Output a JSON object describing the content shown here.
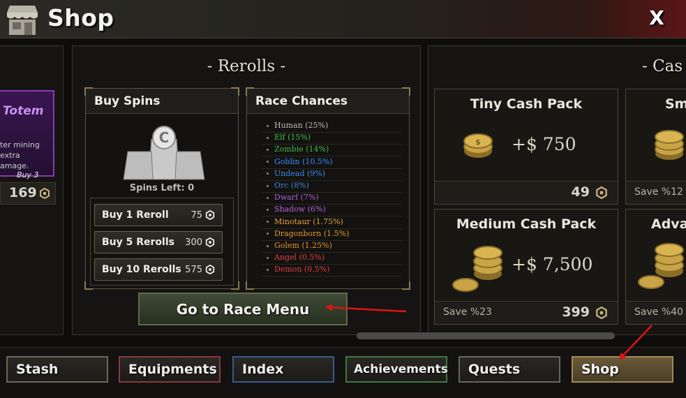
{
  "header": {
    "title": "Shop",
    "close_label": "X"
  },
  "left_card": {
    "title": "Totem",
    "desc_line1": "ter mining",
    "desc_line2": "extra",
    "desc_line3": "amage.",
    "buy_label": "Buy 3",
    "price": "169"
  },
  "rerolls": {
    "heading": "- Rerolls -",
    "buy_spins": {
      "title": "Buy Spins",
      "spins_left": "Spins Left: 0"
    },
    "buttons": [
      {
        "label": "Buy 1 Reroll",
        "price": "75"
      },
      {
        "label": "Buy 5 Rerolls",
        "price": "300"
      },
      {
        "label": "Buy 10 Rerolls",
        "price": "575"
      }
    ],
    "race_chances": {
      "title": "Race Chances",
      "races": [
        {
          "label": "Human (25%)",
          "color": "#bdbdbd"
        },
        {
          "label": "Elf (15%)",
          "color": "#3fbf3f"
        },
        {
          "label": "Zombie (14%)",
          "color": "#46b846"
        },
        {
          "label": "Goblin (10.5%)",
          "color": "#2f90ff"
        },
        {
          "label": "Undead (9%)",
          "color": "#3a8ee8"
        },
        {
          "label": "Orc (8%)",
          "color": "#3b86e0"
        },
        {
          "label": "Dwarf (7%)",
          "color": "#b05bd6"
        },
        {
          "label": "Shadow (6%)",
          "color": "#b763e0"
        },
        {
          "label": "Minotaur (1.75%)",
          "color": "#e8a43a"
        },
        {
          "label": "Dragonborn (1.5%)",
          "color": "#e89a30"
        },
        {
          "label": "Golem (1.25%)",
          "color": "#e2972c"
        },
        {
          "label": "Angel (0.5%)",
          "color": "#e04040"
        },
        {
          "label": "Demon (0.5%)",
          "color": "#e03c3c"
        }
      ]
    },
    "go_button": "Go to Race Menu"
  },
  "cash": {
    "heading": "- Cas",
    "packs": [
      {
        "name": "Tiny Cash Pack",
        "amount": "+$ 750",
        "save": "",
        "price": "49"
      },
      {
        "name": "Sm",
        "amount": "",
        "save": "Save %12",
        "price": ""
      },
      {
        "name": "Medium Cash Pack",
        "amount": "+$ 7,500",
        "save": "Save %23",
        "price": "399"
      },
      {
        "name": "Adva",
        "amount": "",
        "save": "Save %40",
        "price": ""
      }
    ]
  },
  "tabs": [
    {
      "label": "Stash",
      "color": "#6e6657"
    },
    {
      "label": "Equipments",
      "color": "#8a3a3a"
    },
    {
      "label": "Index",
      "color": "#3a5a8a"
    },
    {
      "label": "Achievements",
      "color": "#3f7a3f"
    },
    {
      "label": "Quests",
      "color": "#666666"
    },
    {
      "label": "Shop",
      "color": "#a08a55"
    }
  ],
  "colors": {
    "accent_gold": "#8b7a55",
    "arrow_red": "#e01414"
  }
}
